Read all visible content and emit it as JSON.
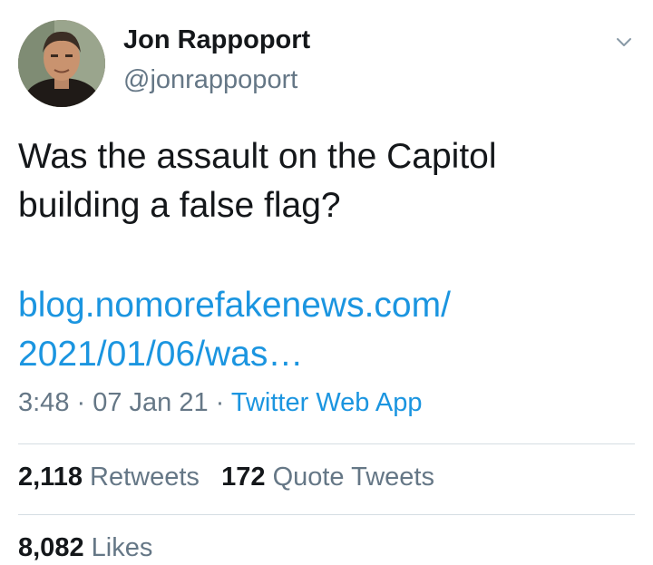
{
  "author": {
    "name": "Jon Rappoport",
    "handle": "@jonrappoport"
  },
  "tweet": {
    "text_lines": [
      "Was the assault on the Capitol",
      "building a false flag?"
    ],
    "link_lines": [
      "blog.nomorefakenews.com/",
      "2021/01/06/was…"
    ]
  },
  "meta": {
    "time": "3:48",
    "separator": " · ",
    "date": "07 Jan 21",
    "source": "Twitter Web App"
  },
  "stats": {
    "retweets_count": "2,118",
    "retweets_label": "Retweets",
    "quotes_count": "172",
    "quotes_label": "Quote Tweets",
    "likes_count": "8,082",
    "likes_label": "Likes"
  },
  "icons": {
    "more": "chevron-down-icon",
    "avatar": "avatar"
  },
  "colors": {
    "link": "#1b95e0",
    "secondary_text": "#657786",
    "primary_text": "#14171a",
    "divider": "#d5dde3"
  }
}
